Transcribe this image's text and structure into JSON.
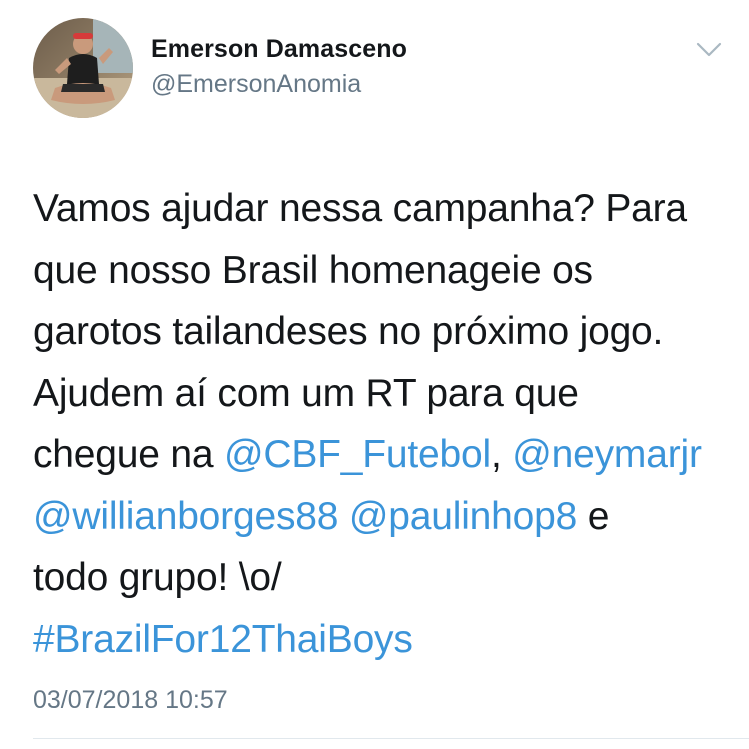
{
  "user": {
    "display_name": "Emerson Damasceno",
    "handle": "@EmersonAnomia",
    "avatar_icon": "profile-photo"
  },
  "menu": {
    "icon": "chevron-down-icon"
  },
  "tweet": {
    "line1": "Vamos ajudar nessa campanha? Para",
    "line2": "que nosso Brasil homenageie os",
    "line3": "garotos tailandeses no próximo jogo.",
    "line4": "Ajudem aí com um RT para que",
    "line5_prefix": "chegue na ",
    "mention_cbf": "@CBF_Futebol",
    "comma": ", ",
    "mention_neymar": "@neymarjr",
    "mention_willian": "@willianborges88",
    "space": " ",
    "mention_paulinho": "@paulinhop8",
    "line6_suffix": " e",
    "line7": "todo grupo! \\o/",
    "hashtag": "#BrazilFor12ThaiBoys"
  },
  "timestamp": "03/07/2018 10:57",
  "colors": {
    "text": "#14171a",
    "secondary": "#657786",
    "link": "#3b94d9",
    "divider": "#e1e8ed"
  }
}
